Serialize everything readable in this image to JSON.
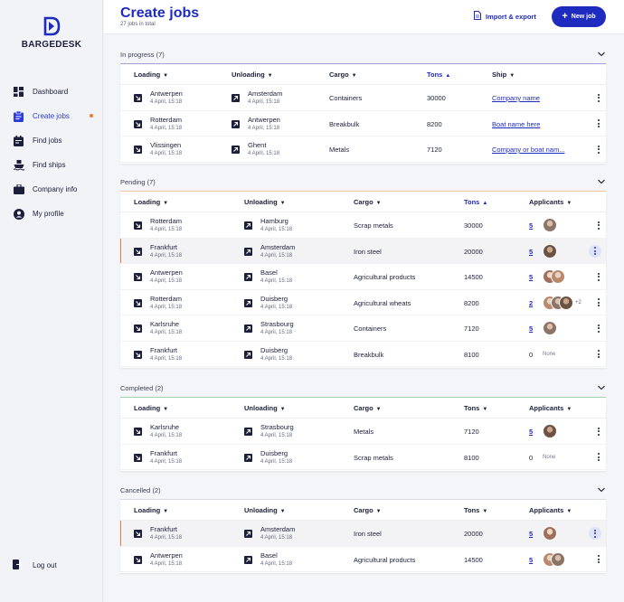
{
  "brand": {
    "name": "BARGEDESK"
  },
  "sidebar": {
    "items": [
      {
        "label": "Dashboard",
        "icon": "grid-icon",
        "active": false
      },
      {
        "label": "Create jobs",
        "icon": "clipboard-icon",
        "active": true
      },
      {
        "label": "Find jobs",
        "icon": "calendar-icon",
        "active": false
      },
      {
        "label": "Find ships",
        "icon": "ship-icon",
        "active": false
      },
      {
        "label": "Company info",
        "icon": "briefcase-icon",
        "active": false
      },
      {
        "label": "My profile",
        "icon": "user-icon",
        "active": false
      }
    ],
    "logout": "Log out"
  },
  "header": {
    "title": "Create jobs",
    "subtitle": "27 jobs in total",
    "import_label": "Import & export",
    "new_label": "New job"
  },
  "colors": {
    "accent": "#1f2bbf",
    "orange": "#f07a3c",
    "in_progress": "#9aa4d6",
    "pending": "#f2c59c",
    "completed": "#9fd3b0",
    "cancelled": "#d8dbe3"
  },
  "sections": [
    {
      "title": "In progress (7)",
      "headers": [
        "Loading",
        "Unloading",
        "Cargo",
        "Tons",
        "Ship"
      ],
      "rows": [
        {
          "load_city": "Antwerpen",
          "load_date": "4 April, 15:18",
          "unload_city": "Amsterdam",
          "unload_date": "4 April, 15:18",
          "cargo": "Containers",
          "tons": "30000",
          "ship": "Company name"
        },
        {
          "load_city": "Rotterdam",
          "load_date": "4 April, 15:18",
          "unload_city": "Antwerpen",
          "unload_date": "4 April, 15:18",
          "cargo": "Breakbulk",
          "tons": "8200",
          "ship": "Boat name here"
        },
        {
          "load_city": "Vlissingen",
          "load_date": "4 April, 15:18",
          "unload_city": "Ghent",
          "unload_date": "4 April, 15:18",
          "cargo": "Metals",
          "tons": "7120",
          "ship": "Company or boat nam..."
        }
      ]
    },
    {
      "title": "Pending (7)",
      "headers": [
        "Loading",
        "Unloading",
        "Cargo",
        "Tons",
        "Applicants"
      ],
      "rows": [
        {
          "load_city": "Rotterdam",
          "load_date": "4 April, 15:18",
          "unload_city": "Hamburg",
          "unload_date": "4 April, 15:18",
          "cargo": "Scrap metals",
          "tons": "30000",
          "applicants": "5",
          "extra": ""
        },
        {
          "load_city": "Frankfurt",
          "load_date": "4 April, 15:18",
          "unload_city": "Amsterdam",
          "unload_date": "4 April, 15:18",
          "cargo": "Iron steel",
          "tons": "20000",
          "applicants": "5",
          "extra": ""
        },
        {
          "load_city": "Antwerpen",
          "load_date": "4 April, 15:18",
          "unload_city": "Basel",
          "unload_date": "4 April, 15:18",
          "cargo": "Agricultural products",
          "tons": "14500",
          "applicants": "5",
          "extra": ""
        },
        {
          "load_city": "Rotterdam",
          "load_date": "4 April, 15:18",
          "unload_city": "Duisberg",
          "unload_date": "4 April, 15:18",
          "cargo": "Agricultural wheats",
          "tons": "8200",
          "applicants": "2",
          "extra": "+2"
        },
        {
          "load_city": "Karlsruhe",
          "load_date": "4 April, 15:18",
          "unload_city": "Strasbourg",
          "unload_date": "4 April, 15:18",
          "cargo": "Containers",
          "tons": "7120",
          "applicants": "5",
          "extra": ""
        },
        {
          "load_city": "Frankfurt",
          "load_date": "4 April, 15:18",
          "unload_city": "Duisberg",
          "unload_date": "4 April, 15:18",
          "cargo": "Breakbulk",
          "tons": "8100",
          "applicants": "0",
          "extra": "None"
        }
      ]
    },
    {
      "title": "Completed (2)",
      "headers": [
        "Loading",
        "Unloading",
        "Cargo",
        "Tons",
        "Applicants"
      ],
      "rows": [
        {
          "load_city": "Karlsruhe",
          "load_date": "4 April, 15:18",
          "unload_city": "Strasbourg",
          "unload_date": "4 April, 15:18",
          "cargo": "Metals",
          "tons": "7120",
          "applicants": "5",
          "extra": ""
        },
        {
          "load_city": "Frankfurt",
          "load_date": "4 April, 15:18",
          "unload_city": "Duisberg",
          "unload_date": "4 April, 15:18",
          "cargo": "Scrap metals",
          "tons": "8100",
          "applicants": "0",
          "extra": "None"
        }
      ]
    },
    {
      "title": "Cancelled (2)",
      "headers": [
        "Loading",
        "Unloading",
        "Cargo",
        "Tons",
        "Applicants"
      ],
      "rows": [
        {
          "load_city": "Frankfurt",
          "load_date": "4 April, 15:18",
          "unload_city": "Amsterdam",
          "unload_date": "4 April, 15:18",
          "cargo": "Iron steel",
          "tons": "20000",
          "applicants": "5",
          "extra": ""
        },
        {
          "load_city": "Antwerpen",
          "load_date": "4 April, 15:18",
          "unload_city": "Basel",
          "unload_date": "4 April, 15:18",
          "cargo": "Agricultural products",
          "tons": "14500",
          "applicants": "5",
          "extra": ""
        }
      ]
    }
  ]
}
